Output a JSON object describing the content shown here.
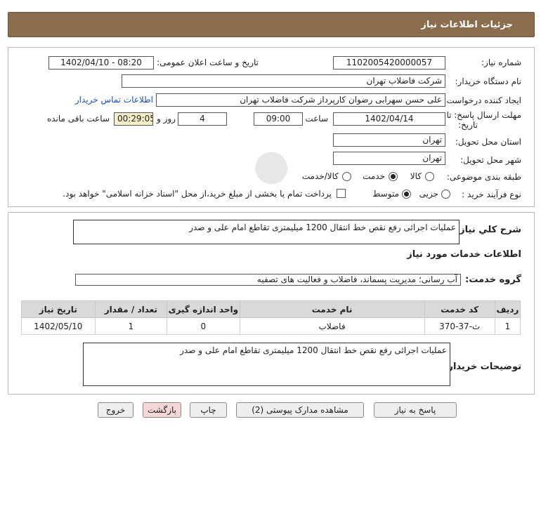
{
  "header": {
    "title": "جزئیات اطلاعات نیاز"
  },
  "form": {
    "need_number_label": "شماره نیاز:",
    "need_number": "1102005420000057",
    "announce_label": "تاریخ و ساعت اعلان عمومی:",
    "announce_value": "1402/04/10 - 08:20",
    "buyer_org_label": "نام دستگاه خریدار:",
    "buyer_org": "شرکت فاضلاب تهران",
    "requester_label": "ایجاد کننده درخواست:",
    "requester": "علی حسن  سهرابی رضوان کارپرداز شرکت فاضلاب تهران",
    "contact_link": "اطلاعات تماس خریدار",
    "deadline_label_1": "مهلت ارسال پاسخ: تا",
    "deadline_label_2": "تاریخ:",
    "deadline_date": "1402/04/14",
    "time_label": "ساعت",
    "deadline_time": "09:00",
    "days_value": "4",
    "days_label": "روز و",
    "remaining_value": "00:29:05",
    "remaining_label": "ساعت باقی مانده",
    "province_label": "استان محل تحویل:",
    "province": "تهران",
    "city_label": "شهر محل تحویل:",
    "city": "تهران",
    "category_label": "طبقه بندی موضوعی:",
    "category_options": [
      "کالا",
      "خدمت",
      "کالا/خدمت"
    ],
    "category_selected": "خدمت",
    "process_label": "نوع فرآیند خرید :",
    "process_options": [
      "جزیی",
      "متوسط"
    ],
    "process_selected": "متوسط",
    "treasury_note": "پرداخت تمام یا بخشی از مبلغ خرید،از محل \"اسناد خزانه اسلامی\" خواهد بود."
  },
  "details": {
    "summary_label": "شرح کلي نياز:",
    "summary": "عملیات اجرائی رفع نقص خط انتقال 1200 میلیمتری تقاطع امام علی و صدر",
    "services_heading": "اطلاعات خدمات مورد نیاز",
    "service_group_label": "گروه خدمت:",
    "service_group": "آب رسانی؛ مدیریت پسماند، فاضلاب و فعالیت های تصفیه",
    "table": {
      "headers": [
        "ردیف",
        "کد خدمت",
        "نام خدمت",
        "واحد اندازه گیری",
        "تعداد / مقدار",
        "تاریخ نیاز"
      ],
      "rows": [
        [
          "1",
          "ث-37-370",
          "فاضلاب",
          "0",
          "1",
          "1402/05/10"
        ]
      ]
    },
    "buyer_notes_label": "توضیحات خریدار:",
    "buyer_notes": "عملیات اجرائی رفع نقص خط انتقال 1200 میلیمتری تقاطع امام علی و صدر"
  },
  "actions": {
    "reply": "پاسخ به نیاز",
    "attachments": "مشاهده مدارک پیوستی (2)",
    "print": "چاپ",
    "back": "بازگشت",
    "exit": "خروج"
  },
  "colors": {
    "header_bg": "#8a6d4c",
    "link": "#1f4fb5",
    "timer_bg": "#f6efc9",
    "back_button_bg": "#f5d7d7"
  }
}
